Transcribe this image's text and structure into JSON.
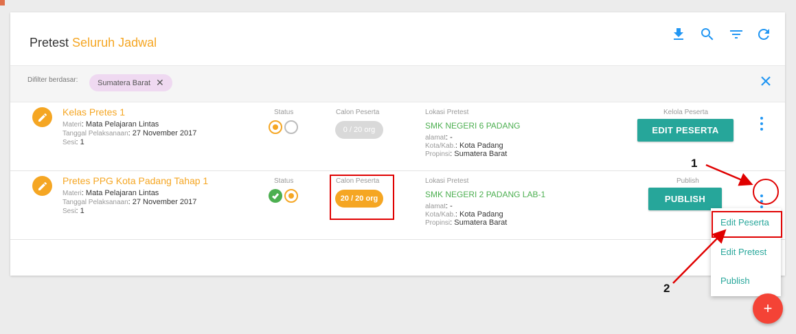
{
  "header": {
    "title_prefix": "Pretest",
    "title_highlight": "Seluruh Jadwal",
    "icons": [
      "download-icon",
      "search-icon",
      "filter-icon",
      "refresh-icon"
    ]
  },
  "filter": {
    "label": "Difilter berdasar:",
    "chip": "Sumatera Barat",
    "chip_close": "✕"
  },
  "rows": [
    {
      "title": "Kelas Pretes 1",
      "materi_key": "Materi",
      "materi": ": Mata Pelajaran Lintas",
      "tanggal_key": "Tanggal Pelaksanaan",
      "tanggal": ": 27 November 2017",
      "sesi_key": "Sesi",
      "sesi": ": 1",
      "status_label": "Status",
      "calon_label": "Calon Peserta",
      "calon_value": "0 / 20 org",
      "lokasi_label": "Lokasi Pretest",
      "lokasi": "SMK NEGERI 6 PADANG",
      "alamat_key": "alamat",
      "alamat": ": -",
      "kota_key": "Kota/Kab.",
      "kota": ": Kota Padang",
      "propinsi_key": "Propinsi",
      "propinsi": ": Sumatera Barat",
      "action_label": "Kelola Peserta",
      "action_button": "EDIT PESERTA"
    },
    {
      "title": "Pretes PPG Kota Padang Tahap 1",
      "materi_key": "Materi",
      "materi": ": Mata Pelajaran Lintas",
      "tanggal_key": "Tanggal Pelaksanaan",
      "tanggal": ": 27 November 2017",
      "sesi_key": "Sesi",
      "sesi": ": 1",
      "status_label": "Status",
      "calon_label": "Calon Peserta",
      "calon_value": "20 / 20 org",
      "lokasi_label": "Lokasi Pretest",
      "lokasi": "SMK NEGERI 2 PADANG LAB-1",
      "alamat_key": "alamat",
      "alamat": ": -",
      "kota_key": "Kota/Kab.",
      "kota": ": Kota Padang",
      "propinsi_key": "Propinsi",
      "propinsi": ": Sumatera Barat",
      "action_label": "Publish",
      "action_button": "PUBLISH"
    }
  ],
  "menu": {
    "items": [
      "Edit Peserta",
      "Edit Pretest",
      "Publish"
    ]
  },
  "fab": {
    "label": "+"
  },
  "annotations": {
    "callout_1": "1",
    "callout_2": "2"
  },
  "colors": {
    "accent_orange": "#f5a623",
    "teal": "#26a69a",
    "blue": "#2196f3",
    "green": "#4caf50",
    "fab_red": "#f44336",
    "annotation_red": "#e00000"
  }
}
